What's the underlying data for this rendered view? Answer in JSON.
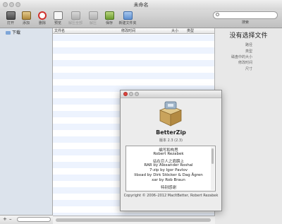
{
  "window": {
    "title": "未命名"
  },
  "toolbar": {
    "buttons": [
      {
        "label": "打开",
        "dim": false
      },
      {
        "label": "添加",
        "dim": false
      },
      {
        "label": "删除",
        "dim": false
      },
      {
        "label": "预览",
        "dim": false
      },
      {
        "label": "解压全部",
        "dim": true
      },
      {
        "label": "解压",
        "dim": true
      },
      {
        "label": "保存",
        "dim": false
      },
      {
        "label": "新建文件夹",
        "dim": false
      }
    ]
  },
  "search": {
    "label": "搜索",
    "placeholder": ""
  },
  "sidebar": {
    "items": [
      {
        "label": "下载"
      }
    ]
  },
  "filelist": {
    "columns": [
      "文件名",
      "修改时间",
      "大小",
      "类型"
    ]
  },
  "info_panel": {
    "title": "没有选择文件",
    "labels": [
      "路径",
      "类型",
      "磁盘中的大小",
      "修改时间",
      "尺寸"
    ]
  },
  "about": {
    "app_name": "BetterZip",
    "version": "版本 2.3 (2.3)",
    "credits": [
      {
        "text": "编写和构思",
        "header": true
      },
      {
        "text": "Robert Rezabek",
        "header": false
      },
      {
        "text": "站在巨人之肩膀上",
        "header": true
      },
      {
        "text": "RAR by Alexander Roshal",
        "header": false
      },
      {
        "text": "7-zip by Igor Pavlov",
        "header": false
      },
      {
        "text": "libxad by Dirk Stöcker & Dag Ågren",
        "header": false
      },
      {
        "text": "xar by Rob Braun",
        "header": false
      },
      {
        "text": "特别感谢",
        "header": true
      }
    ],
    "copyright": "Copyright © 2006–2012 MacItBetter, Robert Rezabek"
  },
  "colors": {
    "sidebar_bg": "#dce3ec",
    "list_stripe": "#edf3fe",
    "close_red": "#e0443e",
    "min_yellow": "#dea123",
    "zoom_green": "#84c454"
  },
  "icons": [
    "open-icon",
    "add-icon",
    "delete-icon",
    "preview-icon",
    "extract-all-icon",
    "extract-icon",
    "save-icon",
    "new-folder-icon",
    "folder-icon",
    "search-icon"
  ]
}
